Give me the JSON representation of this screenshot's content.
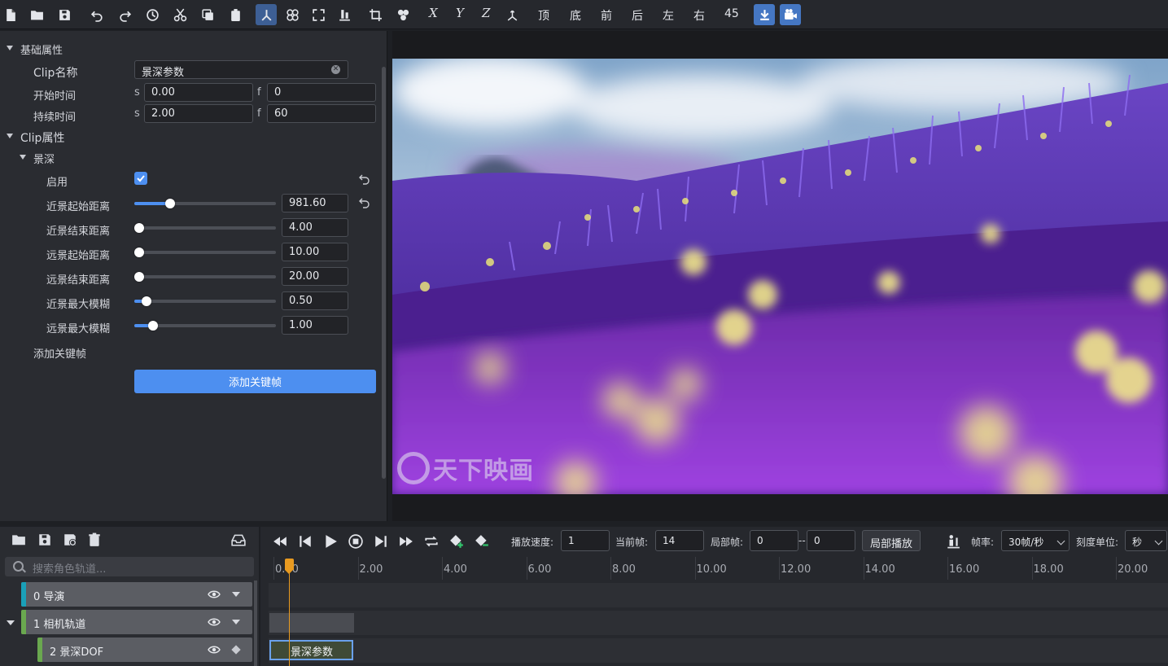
{
  "toolbar": {
    "axis_x": "X",
    "axis_y": "Y",
    "axis_z": "Z",
    "view_top": "顶",
    "view_bottom": "底",
    "view_front": "前",
    "view_back": "后",
    "view_left": "左",
    "view_right": "右",
    "view_45": "45"
  },
  "properties": {
    "basic_section": "基础属性",
    "clip_name_label": "Clip名称",
    "clip_name_value": "景深参数",
    "start_time_label": "开始时间",
    "start_s_prefix": "s",
    "start_s_value": "0.00",
    "start_f_prefix": "f",
    "start_f_value": "0",
    "duration_label": "持续时间",
    "duration_s_prefix": "s",
    "duration_s_value": "2.00",
    "duration_f_prefix": "f",
    "duration_f_value": "60",
    "clip_section": "Clip属性",
    "dof_section": "景深",
    "enable_label": "启用",
    "enable_checked": true,
    "sliders": [
      {
        "label": "近景起始距离",
        "value": "981.60",
        "level": 0.22
      },
      {
        "label": "近景结束距离",
        "value": "4.00",
        "level": 0.0
      },
      {
        "label": "远景起始距离",
        "value": "10.00",
        "level": 0.0
      },
      {
        "label": "远景结束距离",
        "value": "20.00",
        "level": 0.0
      },
      {
        "label": "近景最大模糊",
        "value": "0.50",
        "level": 0.05
      },
      {
        "label": "远景最大模糊",
        "value": "1.00",
        "level": 0.1
      }
    ],
    "add_keyframe_label": "添加关键帧",
    "add_keyframe_button": "添加关键帧"
  },
  "viewport": {
    "watermark": "天下映画"
  },
  "timeline": {
    "search_placeholder": "搜索角色轨道...",
    "tracks": [
      {
        "label": "0 导演",
        "color": "#1aa0b8"
      },
      {
        "label": "1 相机轨道",
        "color": "#6aa84f"
      },
      {
        "label": "2 景深DOF",
        "color": "#6aa84f"
      }
    ],
    "controls": {
      "speed_label": "播放速度:",
      "speed_value": "1",
      "current_frame_label": "当前帧:",
      "current_frame_value": "14",
      "local_frame_label": "局部帧:",
      "local_from": "0",
      "local_sep": "--",
      "local_to": "0",
      "local_play_button": "局部播放",
      "fps_label": "帧率:",
      "fps_value": "30帧/秒",
      "unit_label": "刻度单位:",
      "unit_value": "秒"
    },
    "ruler_ticks": [
      "0.00",
      "2.00",
      "4.00",
      "6.00",
      "8.00",
      "10.00",
      "12.00",
      "14.00",
      "16.00",
      "18.00",
      "20.00"
    ],
    "clip_label": "景深参数",
    "accent_color": "#4d8ff0",
    "playhead_color": "#e89a20"
  }
}
